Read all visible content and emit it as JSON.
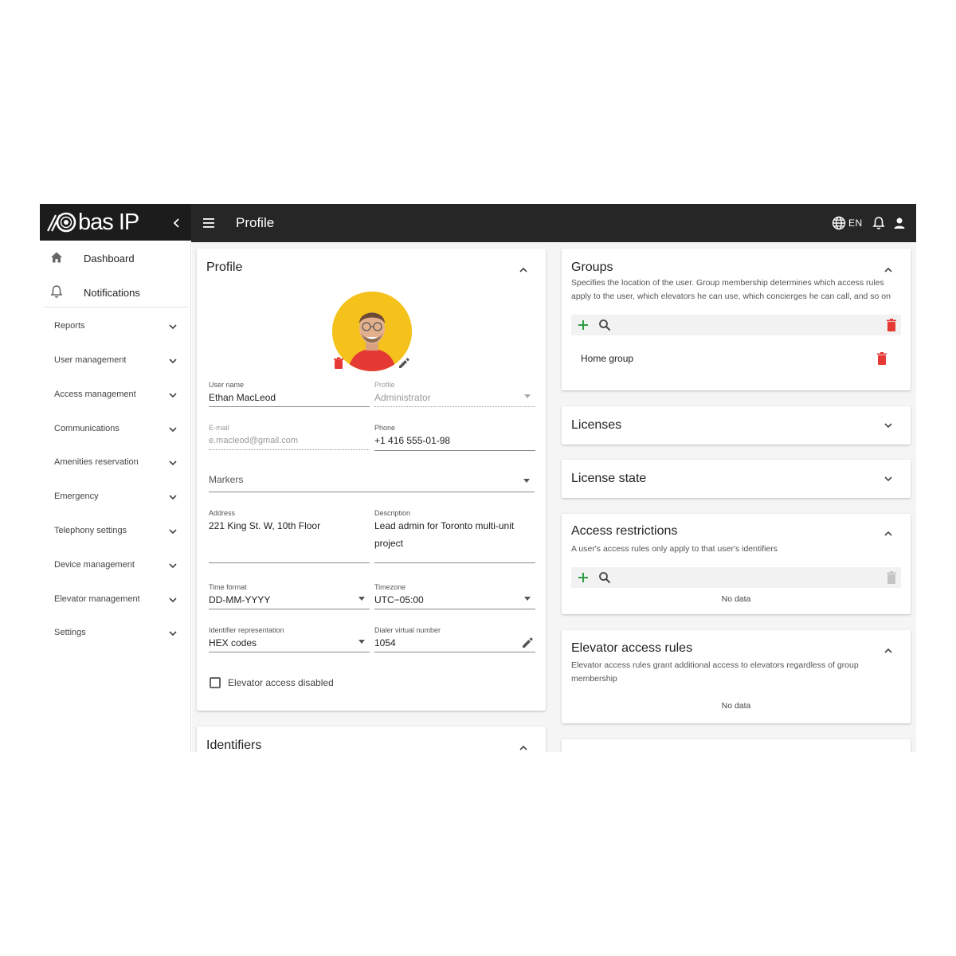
{
  "brand": {
    "logo_text": "bas IP"
  },
  "topbar": {
    "title": "Profile",
    "language": "EN"
  },
  "colors": {
    "topbar": "#262626",
    "accent_add": "#2e9e45",
    "delete": "#e53935",
    "avatar_bg": "#f5c21b"
  },
  "sidebar": {
    "top_items": [
      {
        "label": "Dashboard",
        "icon": "home-icon"
      },
      {
        "label": "Notifications",
        "icon": "bell-icon"
      }
    ],
    "items": [
      {
        "label": "Reports"
      },
      {
        "label": "User management"
      },
      {
        "label": "Access management"
      },
      {
        "label": "Communications"
      },
      {
        "label": "Amenities reservation"
      },
      {
        "label": "Emergency"
      },
      {
        "label": "Telephony settings"
      },
      {
        "label": "Device management"
      },
      {
        "label": "Elevator management"
      },
      {
        "label": "Settings"
      }
    ]
  },
  "profile_card": {
    "title": "Profile",
    "fields": {
      "user_name": {
        "label": "User name",
        "value": "Ethan MacLeod"
      },
      "profile": {
        "label": "Profile",
        "value": "Administrator"
      },
      "email": {
        "label": "E-mail",
        "value": "e.macleod@gmail.com"
      },
      "phone": {
        "label": "Phone",
        "value": "+1 416 555-01-98"
      },
      "markers": {
        "placeholder": "Markers"
      },
      "address": {
        "label": "Address",
        "value": "221 King St. W, 10th Floor"
      },
      "description": {
        "label": "Description",
        "value_line1": "Lead admin for Toronto multi-unit",
        "value_line2": "project"
      },
      "time_format": {
        "label": "Time format",
        "value": "DD-MM-YYYY"
      },
      "timezone": {
        "label": "Timezone",
        "value": "UTC−05:00"
      },
      "identifier_repr": {
        "label": "Identifier representation",
        "value": "HEX codes"
      },
      "dialer_number": {
        "label": "Dialer virtual number",
        "value": "1054"
      }
    },
    "elevator_checkbox": {
      "label": "Elevator access disabled",
      "checked": false
    }
  },
  "identifiers_card": {
    "title": "Identifiers"
  },
  "groups_card": {
    "title": "Groups",
    "desc_line1": "Specifies the location of the user. Group membership determines which access rules",
    "desc_line2": "apply to the user, which elevators he can use, which concierges he can call, and so on",
    "items": [
      {
        "label": "Home group"
      }
    ]
  },
  "licenses_card": {
    "title": "Licenses"
  },
  "license_state_card": {
    "title": "License state"
  },
  "access_restrictions_card": {
    "title": "Access restrictions",
    "desc": "A user's access rules only apply to that user's identifiers",
    "empty": "No data"
  },
  "elevator_rules_card": {
    "title": "Elevator access rules",
    "desc_line1": "Elevator access rules grant additional access to elevators regardless of group",
    "desc_line2": "membership",
    "empty": "No data"
  }
}
